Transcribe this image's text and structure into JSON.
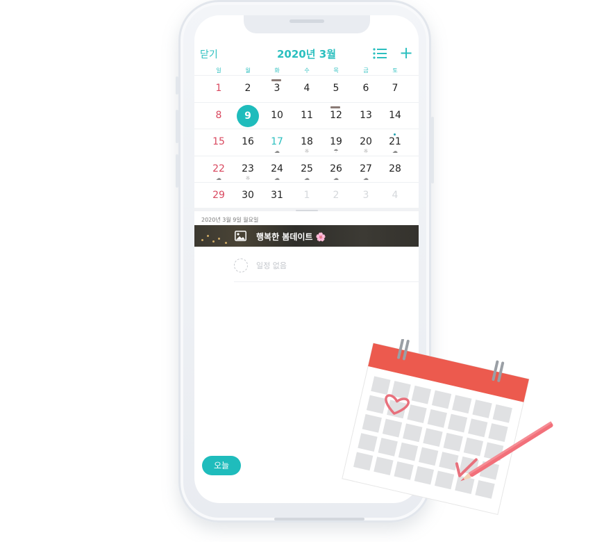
{
  "header": {
    "close_label": "닫기",
    "month_title": "2020년 3월",
    "list_icon": "list-icon",
    "add_icon": "plus-icon"
  },
  "weekdays": [
    "일",
    "월",
    "화",
    "수",
    "목",
    "금",
    "토"
  ],
  "weeks": [
    [
      {
        "n": "1",
        "s": "sun"
      },
      {
        "n": "2"
      },
      {
        "n": "3",
        "strip": true
      },
      {
        "n": "4"
      },
      {
        "n": "5"
      },
      {
        "n": "6"
      },
      {
        "n": "7"
      }
    ],
    [
      {
        "n": "8",
        "s": "sun"
      },
      {
        "n": "9",
        "s": "selected"
      },
      {
        "n": "10"
      },
      {
        "n": "11"
      },
      {
        "n": "12",
        "strip": true
      },
      {
        "n": "13"
      },
      {
        "n": "14"
      }
    ],
    [
      {
        "n": "15",
        "s": "sun"
      },
      {
        "n": "16"
      },
      {
        "n": "17",
        "s": "today",
        "wx": "☁"
      },
      {
        "n": "18",
        "wx": "☼"
      },
      {
        "n": "19",
        "wx": "☂"
      },
      {
        "n": "20",
        "wx": "☼"
      },
      {
        "n": "21",
        "wx": "☁",
        "dot": true
      }
    ],
    [
      {
        "n": "22",
        "s": "sun",
        "wx": "☁"
      },
      {
        "n": "23",
        "wx": "☼"
      },
      {
        "n": "24",
        "wx": "☁"
      },
      {
        "n": "25",
        "wx": "☁"
      },
      {
        "n": "26",
        "wx": "☁"
      },
      {
        "n": "27",
        "wx": "☁"
      },
      {
        "n": "28"
      }
    ],
    [
      {
        "n": "29",
        "s": "sun"
      },
      {
        "n": "30"
      },
      {
        "n": "31"
      },
      {
        "n": "1",
        "s": "other"
      },
      {
        "n": "2",
        "s": "other"
      },
      {
        "n": "3",
        "s": "other"
      },
      {
        "n": "4",
        "s": "other"
      }
    ]
  ],
  "selected_date_label": "2020년 3월 9일 월요일",
  "event": {
    "title": "행복한 봄데이트 🌸",
    "icon": "image-icon"
  },
  "no_schedule_label": "일정 없음",
  "today_button": "오늘",
  "colors": {
    "accent": "#1fbcbc",
    "sunday": "#d9485f",
    "illustration_header": "#ec5a4e",
    "illustration_marks": "#e8707c"
  }
}
